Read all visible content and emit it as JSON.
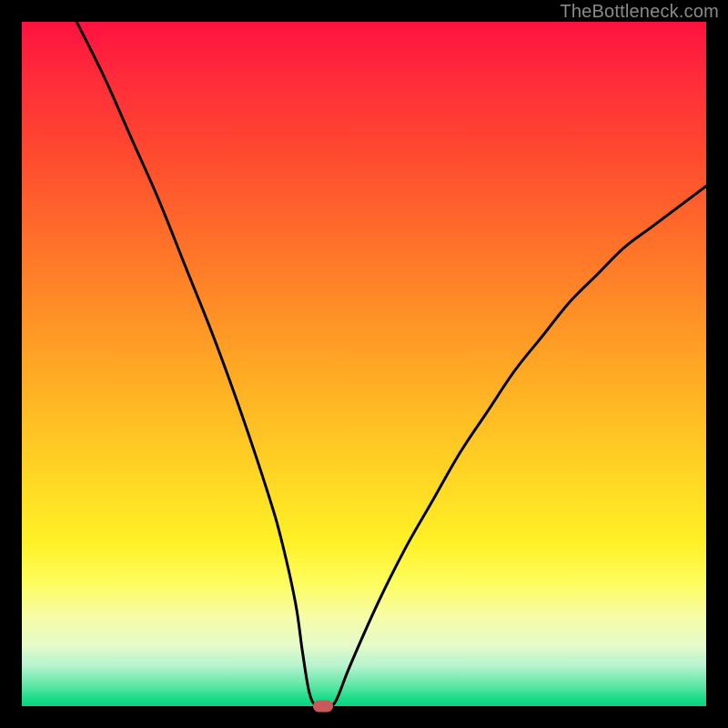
{
  "watermark": "TheBottleneck.com",
  "colors": {
    "background": "#000000",
    "curve": "#000000",
    "marker": "#c95858"
  },
  "chart_data": {
    "type": "line",
    "title": "",
    "xlabel": "",
    "ylabel": "",
    "xlim": [
      0,
      100
    ],
    "ylim": [
      0,
      100
    ],
    "grid": false,
    "axes_visible": false,
    "series": [
      {
        "name": "bottleneck-curve",
        "x": [
          8,
          12,
          16,
          20,
          24,
          28,
          32,
          36,
          38,
          40,
          41,
          42,
          43,
          44,
          45,
          46,
          48,
          52,
          56,
          60,
          64,
          68,
          72,
          76,
          80,
          84,
          88,
          92,
          96,
          100
        ],
        "values": [
          100,
          92,
          83,
          74,
          64,
          54,
          43,
          31,
          24,
          15,
          8,
          2,
          0,
          0,
          0,
          1,
          6,
          15,
          23,
          30,
          37,
          43,
          49,
          54,
          59,
          63,
          67,
          70,
          73,
          76
        ]
      }
    ],
    "marker": {
      "x": 44,
      "y": 0
    },
    "gradient_stops": [
      {
        "pos": 0,
        "color": "#ff1240"
      },
      {
        "pos": 18,
        "color": "#ff4630"
      },
      {
        "pos": 42,
        "color": "#ff8e26"
      },
      {
        "pos": 66,
        "color": "#ffd524"
      },
      {
        "pos": 82,
        "color": "#fdfd5e"
      },
      {
        "pos": 94,
        "color": "#b8f4cf"
      },
      {
        "pos": 100,
        "color": "#0bd480"
      }
    ]
  }
}
